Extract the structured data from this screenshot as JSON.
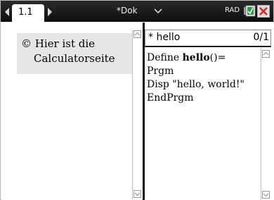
{
  "topbar": {
    "tab_label": "1.1",
    "doc_title": "*Dok",
    "angle_mode": "RAD"
  },
  "left_pane": {
    "symbol": "©",
    "line1": "Hier ist die",
    "line2": "Calculatorseite"
  },
  "program_editor": {
    "name": "* hello",
    "counter": "0/1",
    "lines": {
      "l1_a": "Define ",
      "l1_b": "hello",
      "l1_c": "()=",
      "l2": "Prgm",
      "l3": "Disp \"hello, world!\"",
      "l4": "EndPrgm"
    }
  },
  "icons": {
    "close": "close-icon",
    "battery": "battery-icon",
    "nav_left": "tab-prev-icon",
    "nav_right": "tab-next-icon",
    "doc_menu": "chevron-down-icon"
  },
  "colors": {
    "topbar": "#1a1a1a",
    "close_x": "#d3261c",
    "battery": "#2b9d3a",
    "selection": "#e6e6e6"
  }
}
